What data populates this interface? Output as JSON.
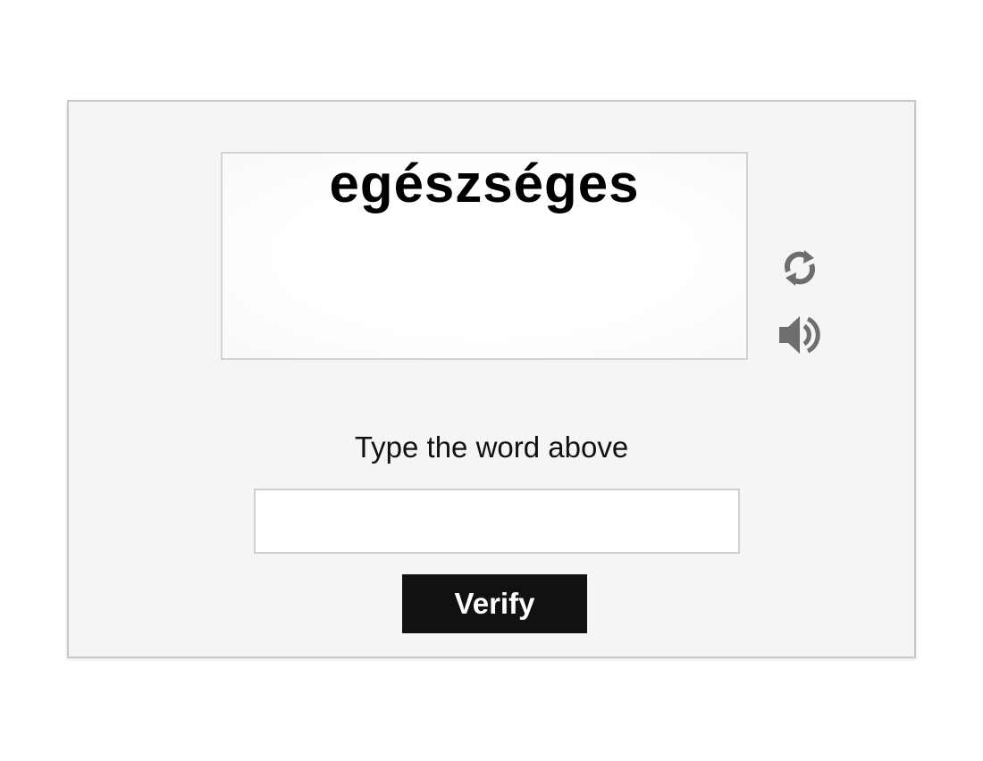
{
  "captcha": {
    "word": "egészséges",
    "prompt": "Type the word above",
    "input_value": "",
    "input_placeholder": "",
    "verify_label": "Verify",
    "icons": {
      "refresh": "refresh-icon",
      "audio": "speaker-icon"
    }
  },
  "colors": {
    "panel_background": "#f5f5f5",
    "button_background": "#111111",
    "button_text": "#ffffff",
    "icon_color": "#6e6e6e"
  }
}
